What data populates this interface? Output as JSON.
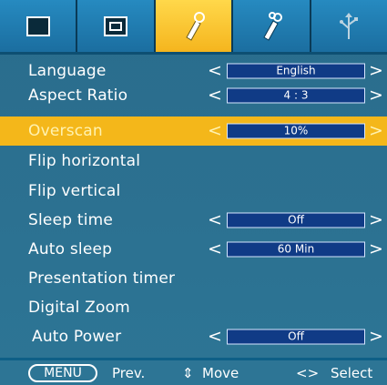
{
  "tabs": [
    {
      "icon": "picture-tab-icon"
    },
    {
      "icon": "screen-tab-icon"
    },
    {
      "icon": "tools-tab-icon",
      "active": true
    },
    {
      "icon": "tools-advanced-tab-icon"
    },
    {
      "icon": "usb-tab-icon"
    }
  ],
  "menu": {
    "language": {
      "label": "Language",
      "value": "English"
    },
    "aspect_ratio": {
      "label": "Aspect Ratio",
      "value": "4 : 3"
    },
    "overscan": {
      "label": "Overscan",
      "value": "10%"
    },
    "flip_horizontal": {
      "label": "Flip horizontal"
    },
    "flip_vertical": {
      "label": "Flip vertical"
    },
    "sleep_time": {
      "label": "Sleep time",
      "value": "Off"
    },
    "auto_sleep": {
      "label": "Auto sleep",
      "value": "60 Min"
    },
    "presentation_timer": {
      "label": "Presentation timer"
    },
    "digital_zoom": {
      "label": "Digital Zoom"
    },
    "auto_power": {
      "label": "Auto Power",
      "value": "Off"
    },
    "arrow_left": "<",
    "arrow_right": ">"
  },
  "footer": {
    "menu_key": "MENU",
    "prev": "Prev.",
    "move_glyph": "⇕",
    "move": "Move",
    "select_glyph": "<>",
    "select": "Select"
  },
  "colors": {
    "background": "#2b6f8f",
    "tab_active": "#f5b51e",
    "selected_row": "#f4b71a",
    "value_box": "#103b86"
  }
}
